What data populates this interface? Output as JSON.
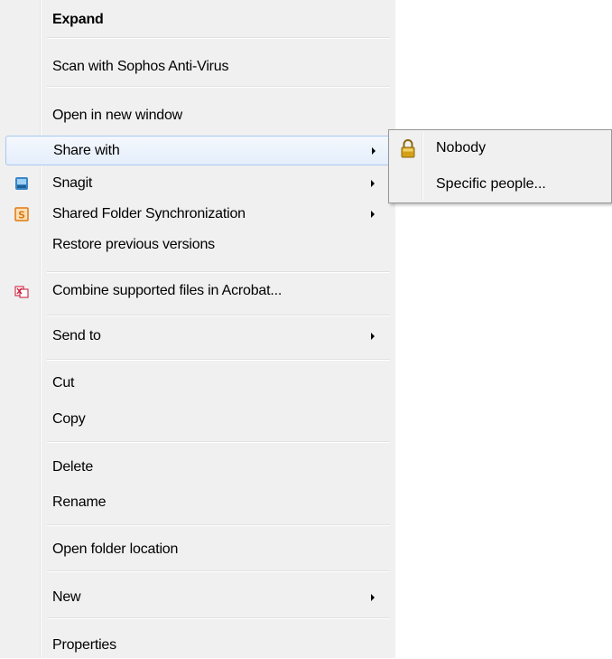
{
  "context_menu": {
    "items": [
      {
        "label": "Expand"
      },
      {
        "label": "Scan with Sophos Anti-Virus"
      },
      {
        "label": "Open in new window"
      },
      {
        "label": "Share with"
      },
      {
        "label": "Snagit"
      },
      {
        "label": "Shared Folder Synchronization"
      },
      {
        "label": "Restore previous versions"
      },
      {
        "label": "Combine supported files in Acrobat..."
      },
      {
        "label": "Send to"
      },
      {
        "label": "Cut"
      },
      {
        "label": "Copy"
      },
      {
        "label": "Delete"
      },
      {
        "label": "Rename"
      },
      {
        "label": "Open folder location"
      },
      {
        "label": "New"
      },
      {
        "label": "Properties"
      }
    ]
  },
  "share_submenu": {
    "items": [
      {
        "label": "Nobody",
        "icon": "padlock-icon"
      },
      {
        "label": "Specific people..."
      }
    ]
  },
  "colors": {
    "menu_background": "#f0f0f0",
    "highlight_border": "#a8c8f0",
    "snagit_icon": "#3a86c8",
    "sync_icon": "#e07a10",
    "acrobat_icon": "#c8102e",
    "padlock": "#d4a017"
  }
}
